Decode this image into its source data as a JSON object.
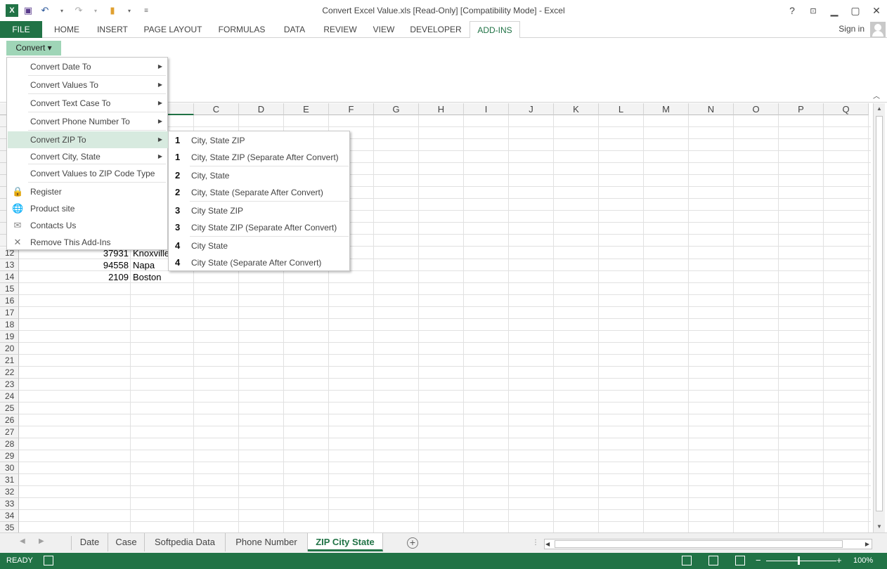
{
  "window": {
    "title": "Convert Excel Value.xls  [Read-Only]  [Compatibility Mode] - Excel",
    "help": "?",
    "minimize": "▁",
    "restore": "▢",
    "close": "✕"
  },
  "qat": {
    "logo": "X",
    "save": "💾",
    "undo": "↶",
    "redo": "↷",
    "open": "📂",
    "more": "⌄"
  },
  "tabs": {
    "file": "FILE",
    "items": [
      "HOME",
      "INSERT",
      "PAGE LAYOUT",
      "FORMULAS",
      "DATA",
      "REVIEW",
      "VIEW",
      "DEVELOPER",
      "ADD-INS"
    ],
    "active": "ADD-INS",
    "signin": "Sign in"
  },
  "ribbon": {
    "convert_label": "Convert ▾"
  },
  "menu": {
    "items": [
      {
        "label": "Convert Date To",
        "submenu": true
      },
      {
        "label": "Convert Values To",
        "submenu": true
      },
      {
        "label": "Convert Text Case To",
        "submenu": true
      },
      {
        "label": "Convert Phone Number To",
        "submenu": true
      },
      {
        "label": "Convert ZIP To",
        "submenu": true
      },
      {
        "label": "Convert City, State",
        "submenu": true
      },
      {
        "label": "Convert Values to ZIP Code Type",
        "submenu": false
      },
      {
        "label": "Register",
        "icon": "lock-icon"
      },
      {
        "label": "Product site",
        "icon": "globe-icon"
      },
      {
        "label": "Contacts Us",
        "icon": "mail-icon"
      },
      {
        "label": "Remove This Add-Ins",
        "icon": "close-icon"
      }
    ]
  },
  "submenu": {
    "items": [
      {
        "num": "1",
        "label": "City, State ZIP"
      },
      {
        "num": "1",
        "label": "City, State ZIP (Separate After Convert)"
      },
      {
        "num": "2",
        "label": "City, State"
      },
      {
        "num": "2",
        "label": "City, State (Separate After Convert)"
      },
      {
        "num": "3",
        "label": "City State ZIP"
      },
      {
        "num": "3",
        "label": "City State ZIP (Separate After Convert)"
      },
      {
        "num": "4",
        "label": "City State"
      },
      {
        "num": "4",
        "label": "City State (Separate After Convert)"
      }
    ]
  },
  "grid": {
    "columns": [
      "C",
      "D",
      "E",
      "F",
      "G",
      "H",
      "I",
      "J",
      "K",
      "L",
      "M",
      "N",
      "O",
      "P",
      "Q"
    ],
    "rows": [
      "12",
      "13",
      "14",
      "15",
      "16",
      "17",
      "18",
      "19",
      "20",
      "21",
      "22",
      "23",
      "24",
      "25",
      "26",
      "27",
      "28",
      "29",
      "30",
      "31",
      "32",
      "33",
      "34",
      "35"
    ],
    "cells": [
      {
        "zip": "37931",
        "city": "Knoxville"
      },
      {
        "zip": "94558",
        "city": "Napa"
      },
      {
        "zip": "2109",
        "city": "Boston"
      }
    ],
    "row_header_m": "M"
  },
  "sheets": {
    "tabs": [
      "Date",
      "Case",
      "Softpedia Data",
      "Phone Number",
      "ZIP City State"
    ],
    "active": "ZIP City State",
    "add": "+"
  },
  "status": {
    "ready": "READY",
    "zoom": "100%",
    "minus": "−",
    "plus": "+"
  },
  "colors": {
    "accent": "#217346",
    "highlight": "#d7eadf"
  }
}
